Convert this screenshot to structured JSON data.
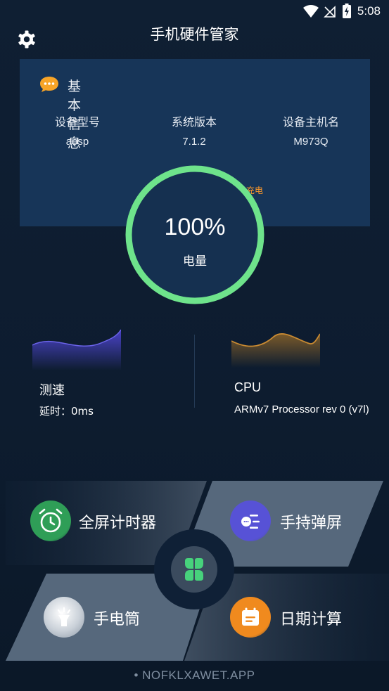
{
  "status": {
    "time": "5:08"
  },
  "header": {
    "title": "手机硬件管家"
  },
  "info": {
    "title": "基本信息",
    "columns": [
      {
        "label": "设备型号",
        "value": "aosp"
      },
      {
        "label": "系统版本",
        "value": "7.1.2"
      },
      {
        "label": "设备主机名",
        "value": "M973Q"
      }
    ],
    "charging": "充电"
  },
  "battery": {
    "percent_text": "100%",
    "label": "电量",
    "level": 1.0,
    "ring_color": "#6ee38b"
  },
  "speed": {
    "title": "测速",
    "latency": "延时：0ms"
  },
  "cpu": {
    "title": "CPU",
    "detail": "ARMv7 Processor rev 0 (v7l)"
  },
  "tools": [
    {
      "label": "全屏计时器",
      "icon": "alarm-clock-icon",
      "color": "#2f9e57"
    },
    {
      "label": "手持弹屏",
      "icon": "chat-list-icon",
      "color": "#5752d6"
    },
    {
      "label": "手电筒",
      "icon": "flashlight-icon",
      "color": "#b7c0cc"
    },
    {
      "label": "日期计算",
      "icon": "calendar-icon",
      "color": "#f08a1e"
    }
  ],
  "center": {
    "icon": "clover-icon",
    "color": "#47d27c"
  },
  "footer": {
    "text": "• NOFKLXAWET.APP"
  }
}
